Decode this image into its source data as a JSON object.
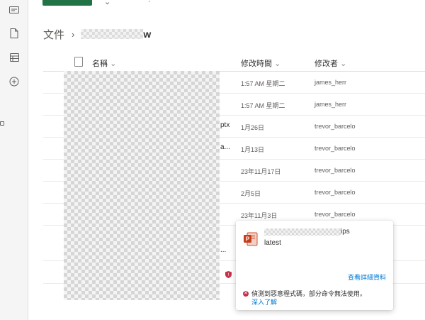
{
  "colors": {
    "accent": "#217346",
    "link": "#0078d4",
    "error": "#c4314b",
    "ppt": "#c43e1c"
  },
  "breadcrumb": {
    "root": "文件",
    "current": "w"
  },
  "columns": {
    "name": "名稱",
    "modified": "修改時間",
    "modified_by": "修改者"
  },
  "rows": [
    {
      "name": "",
      "modified": "1:57 AM 星期二",
      "by": "james_herr"
    },
    {
      "name": "",
      "modified": "1:57 AM 星期二",
      "by": "james_herr"
    },
    {
      "name": "ptx",
      "modified": "1月26日",
      "by": "trevor_barcelo"
    },
    {
      "name": "a...",
      "modified": "1月13日",
      "by": "trevor_barcelo"
    },
    {
      "name": "",
      "modified": "23年11月17日",
      "by": "trevor_barcelo"
    },
    {
      "name": "",
      "modified": "2月5日",
      "by": "trevor_barcelo"
    },
    {
      "name": "",
      "modified": "23年11月3日",
      "by": "trevor_barcelo"
    }
  ],
  "extra_rows": [
    {
      "name": "..."
    },
    {
      "name": ""
    }
  ],
  "popup": {
    "file_suffix": "ips",
    "subtitle": "latest",
    "details_link": "查看詳細資料",
    "error_text": "偵測到惡意程式碼，部分命令無法使用。",
    "learn_more": "深入了解"
  }
}
